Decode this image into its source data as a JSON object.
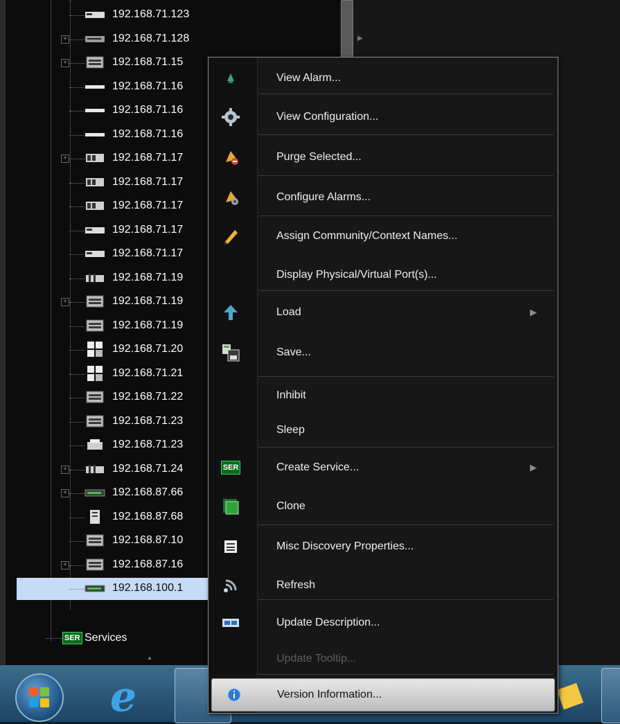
{
  "tree": {
    "rows": [
      {
        "label": "192.168.71.123",
        "icon": "rack-device-icon",
        "expander": ""
      },
      {
        "label": "192.168.71.128",
        "icon": "switch-device-icon",
        "expander": "+"
      },
      {
        "label": "192.168.71.15",
        "icon": "server-device-icon",
        "expander": "+"
      },
      {
        "label": "192.168.71.16",
        "icon": "flat-device-icon",
        "expander": ""
      },
      {
        "label": "192.168.71.16",
        "icon": "flat-device-icon",
        "expander": ""
      },
      {
        "label": "192.168.71.16",
        "icon": "flat-device-icon",
        "expander": ""
      },
      {
        "label": "192.168.71.17",
        "icon": "chassis-device-icon",
        "expander": "+"
      },
      {
        "label": "192.168.71.17",
        "icon": "chassis-device-icon",
        "expander": ""
      },
      {
        "label": "192.168.71.17",
        "icon": "chassis-device-icon",
        "expander": ""
      },
      {
        "label": "192.168.71.17",
        "icon": "rack-device-icon",
        "expander": ""
      },
      {
        "label": "192.168.71.17",
        "icon": "rack-device-icon",
        "expander": ""
      },
      {
        "label": "192.168.71.19",
        "icon": "card-device-icon",
        "expander": ""
      },
      {
        "label": "192.168.71.19",
        "icon": "server-device-icon",
        "expander": "+"
      },
      {
        "label": "192.168.71.19",
        "icon": "server-device-icon",
        "expander": ""
      },
      {
        "label": "192.168.71.20",
        "icon": "panel-device-icon",
        "expander": ""
      },
      {
        "label": "192.168.71.21",
        "icon": "panel-device-icon",
        "expander": ""
      },
      {
        "label": "192.168.71.22",
        "icon": "server-device-icon",
        "expander": ""
      },
      {
        "label": "192.168.71.23",
        "icon": "server-device-icon",
        "expander": ""
      },
      {
        "label": "192.168.71.23",
        "icon": "printer-device-icon",
        "expander": ""
      },
      {
        "label": "192.168.71.24",
        "icon": "card-device-icon",
        "expander": "+"
      },
      {
        "label": "192.168.87.66",
        "icon": "green-device-icon",
        "expander": "+"
      },
      {
        "label": "192.168.87.68",
        "icon": "tower-device-icon",
        "expander": ""
      },
      {
        "label": "192.168.87.10",
        "icon": "server-device-icon",
        "expander": ""
      },
      {
        "label": "192.168.87.16",
        "icon": "server-device-icon",
        "expander": "+"
      },
      {
        "label": "192.168.100.1",
        "icon": "green-device-icon",
        "expander": ""
      }
    ],
    "services_label": "Services",
    "services_badge": "SER"
  },
  "menu": {
    "items": [
      {
        "label": "View Alarm...",
        "icon": "alarm-bell-icon",
        "submenu": false,
        "disabled": false
      },
      {
        "label": "View Configuration...",
        "icon": "gear-icon",
        "submenu": false,
        "disabled": false
      },
      {
        "label": "Purge Selected...",
        "icon": "purge-bell-icon",
        "submenu": false,
        "disabled": false
      },
      {
        "label": "Configure Alarms...",
        "icon": "configure-bell-icon",
        "submenu": false,
        "disabled": false
      },
      {
        "label": "Assign Community/Context Names...",
        "icon": "pencil-icon",
        "submenu": false,
        "disabled": false
      },
      {
        "label": "Display Physical/Virtual Port(s)...",
        "icon": "",
        "submenu": false,
        "disabled": false
      },
      {
        "label": "Load",
        "icon": "load-arrow-icon",
        "submenu": true,
        "disabled": false
      },
      {
        "label": "Save...",
        "icon": "save-disk-icon",
        "submenu": false,
        "disabled": false
      },
      {
        "label": "Inhibit",
        "icon": "",
        "submenu": false,
        "disabled": false
      },
      {
        "label": "Sleep",
        "icon": "",
        "submenu": false,
        "disabled": false
      },
      {
        "label": "Create Service...",
        "icon": "service-badge-icon",
        "submenu": true,
        "disabled": false
      },
      {
        "label": "Clone",
        "icon": "clone-board-icon",
        "submenu": false,
        "disabled": false
      },
      {
        "label": "Misc Discovery Properties...",
        "icon": "properties-list-icon",
        "submenu": false,
        "disabled": false
      },
      {
        "label": "Refresh",
        "icon": "refresh-signal-icon",
        "submenu": false,
        "disabled": false
      },
      {
        "label": "Update Description...",
        "icon": "description-card-icon",
        "submenu": false,
        "disabled": false
      },
      {
        "label": "Update Tooltip...",
        "icon": "",
        "submenu": false,
        "disabled": true
      },
      {
        "label": "Version Information...",
        "icon": "info-icon",
        "submenu": false,
        "disabled": false
      }
    ],
    "service_badge": "SER"
  },
  "colors": {
    "menu_bg": "#171717",
    "selected_row": "#c6dbf6",
    "taskbar": "#2e5a7b"
  }
}
